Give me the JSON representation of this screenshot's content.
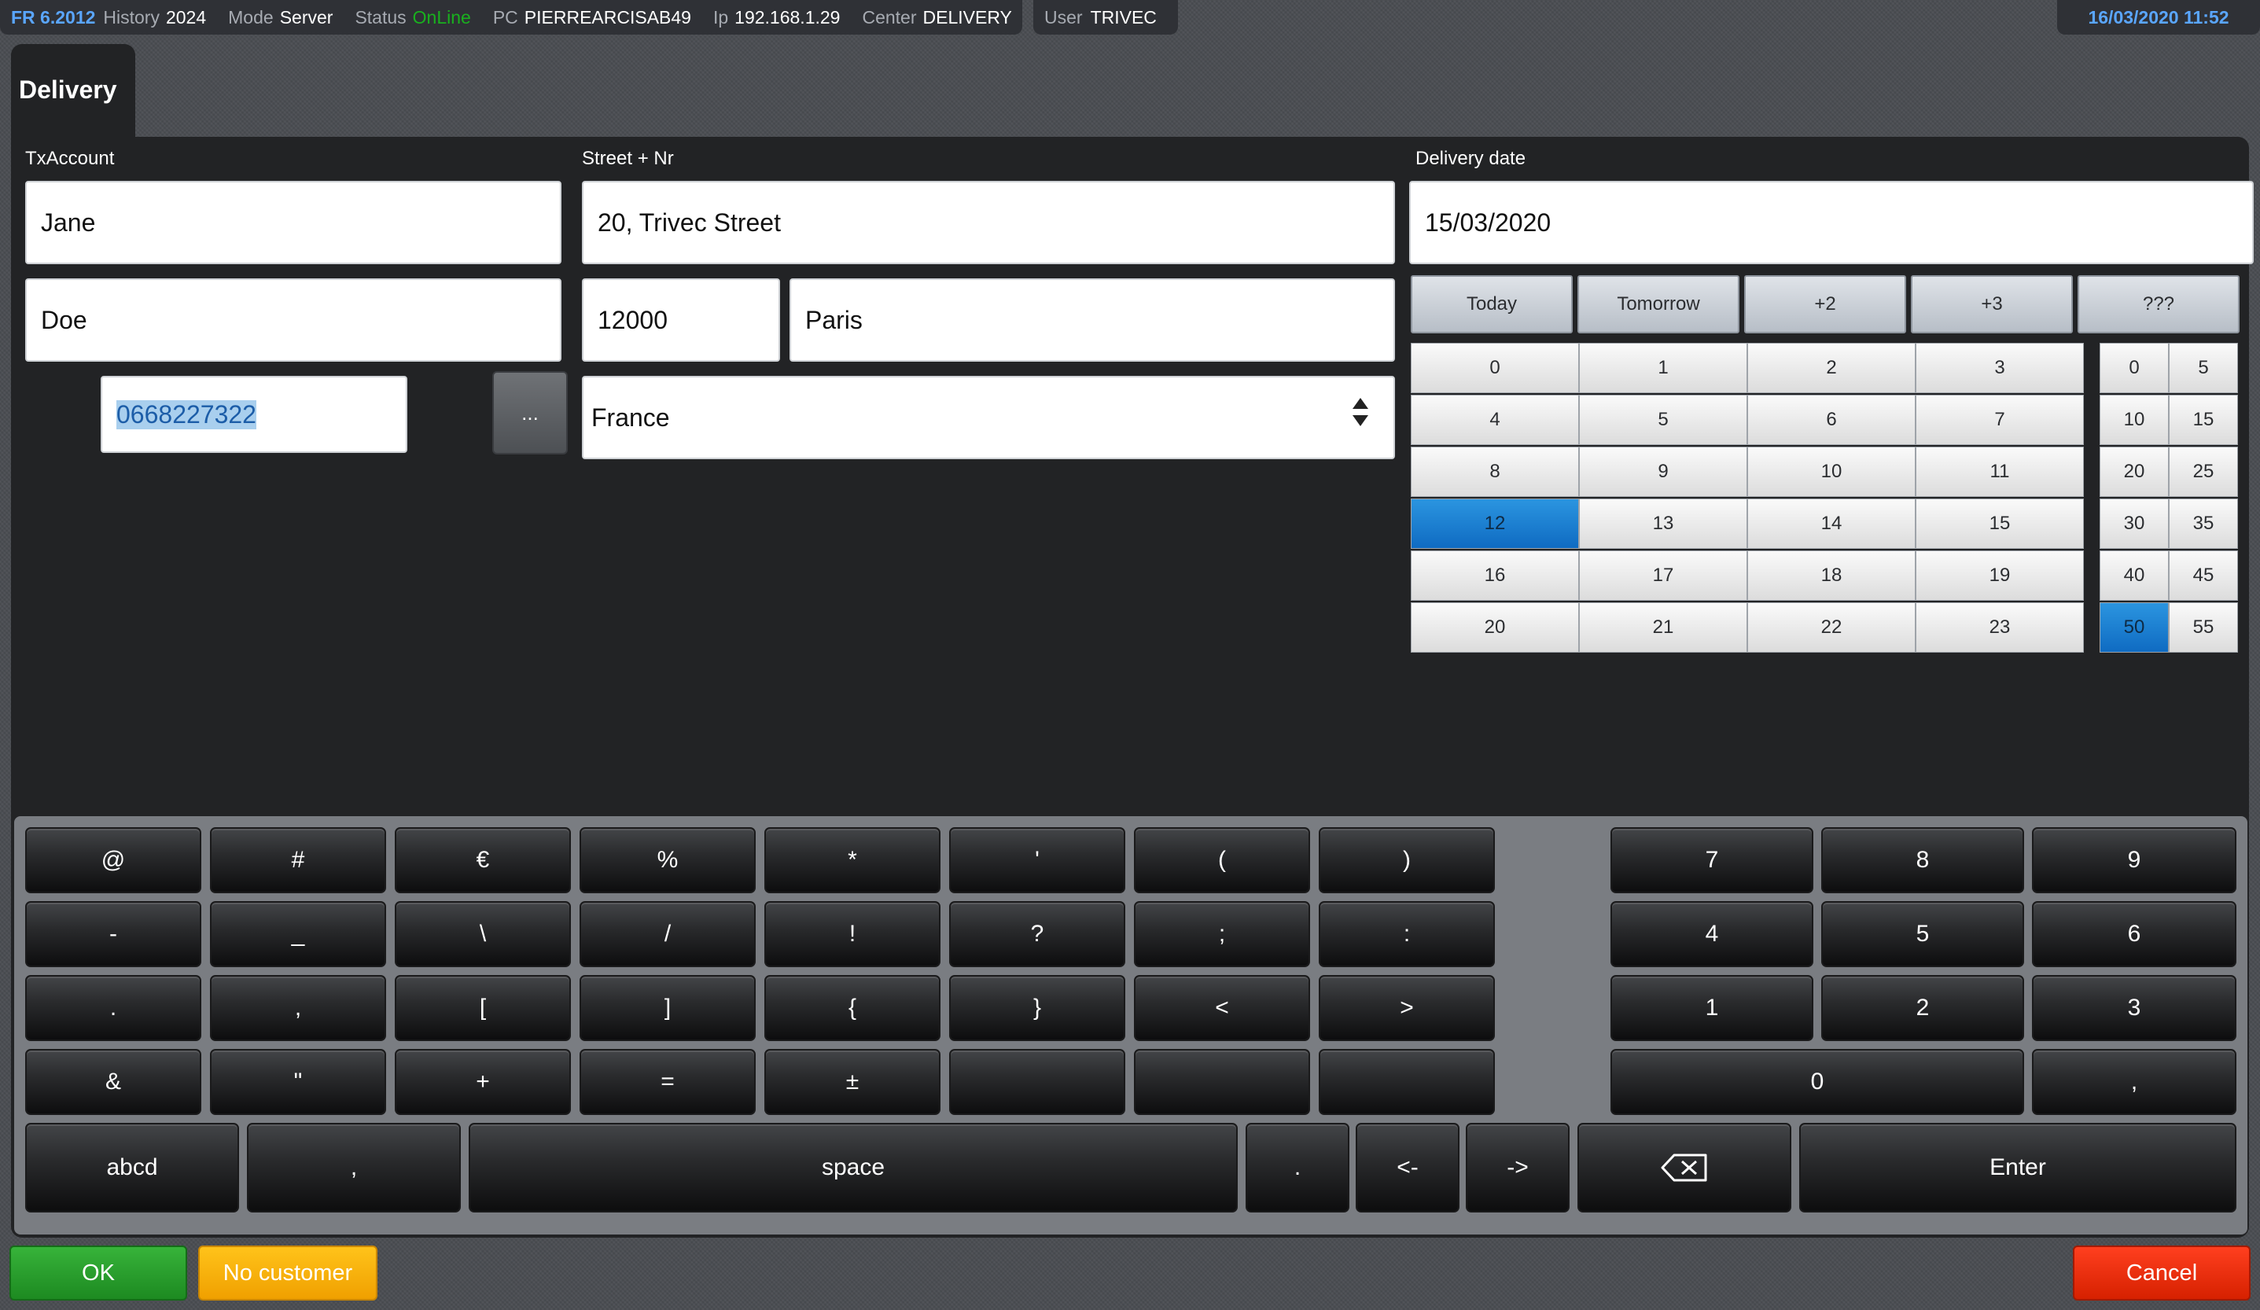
{
  "status_bar": {
    "version": "FR 6.2012",
    "items": [
      {
        "key": "History",
        "value": "2024"
      },
      {
        "key": "Mode",
        "value": "Server"
      },
      {
        "key": "Status",
        "value": "OnLine"
      },
      {
        "key": "PC",
        "value": "PIERREARCISAB49"
      },
      {
        "key": "Ip",
        "value": "192.168.1.29"
      },
      {
        "key": "Center",
        "value": "DELIVERY"
      }
    ],
    "user": {
      "key": "User",
      "value": "TRIVEC"
    },
    "datetime": "16/03/2020 11:52",
    "colors": {
      "version": "#5aa6ff",
      "online": "#19b01e",
      "datetime": "#5aa6ff"
    }
  },
  "tab": {
    "title": "Delivery"
  },
  "form": {
    "txaccount_label": "TxAccount",
    "first_name": "Jane",
    "last_name": "Doe",
    "phone": "0668227322",
    "more_button": "...",
    "street_label": "Street + Nr",
    "street": "20, Trivec Street",
    "zip": "12000",
    "city": "Paris",
    "country": "France",
    "delivery_date_label": "Delivery date",
    "delivery_date": "15/03/2020"
  },
  "date_shortcuts": [
    "Today",
    "Tomorrow",
    "+2",
    "+3",
    "???"
  ],
  "hours": [
    "0",
    "1",
    "2",
    "3",
    "4",
    "5",
    "6",
    "7",
    "8",
    "9",
    "10",
    "11",
    "12",
    "13",
    "14",
    "15",
    "16",
    "17",
    "18",
    "19",
    "20",
    "21",
    "22",
    "23"
  ],
  "hour_selected": "12",
  "minutes": [
    "0",
    "5",
    "10",
    "15",
    "20",
    "25",
    "30",
    "35",
    "40",
    "45",
    "50",
    "55"
  ],
  "minute_selected": "50",
  "keyboard": {
    "symbol_rows": [
      [
        "@",
        "#",
        "€",
        "%",
        "*",
        "'",
        "(",
        ")"
      ],
      [
        "-",
        "_",
        "\\",
        "/",
        "!",
        "?",
        ";",
        ":"
      ],
      [
        ".",
        ",",
        "[",
        "]",
        "{",
        "}",
        "<",
        ">"
      ],
      [
        "&",
        "\"",
        "+",
        "=",
        "±",
        "",
        "",
        ""
      ]
    ],
    "numpad_rows": [
      [
        "7",
        "8",
        "9"
      ],
      [
        "4",
        "5",
        "6"
      ],
      [
        "1",
        "2",
        "3"
      ]
    ],
    "numpad_zero": "0",
    "numpad_comma": ",",
    "bottom_row": {
      "abcd": "abcd",
      "comma": ",",
      "space": "space",
      "period": ".",
      "left": "<-",
      "right": "->",
      "enter": "Enter"
    }
  },
  "actions": {
    "ok": "OK",
    "no_customer": "No customer",
    "cancel": "Cancel"
  },
  "accent": {
    "selected": "#1a7fd4",
    "ok": "#2aa02d",
    "warning": "#f7b500",
    "cancel": "#f02e0a"
  }
}
